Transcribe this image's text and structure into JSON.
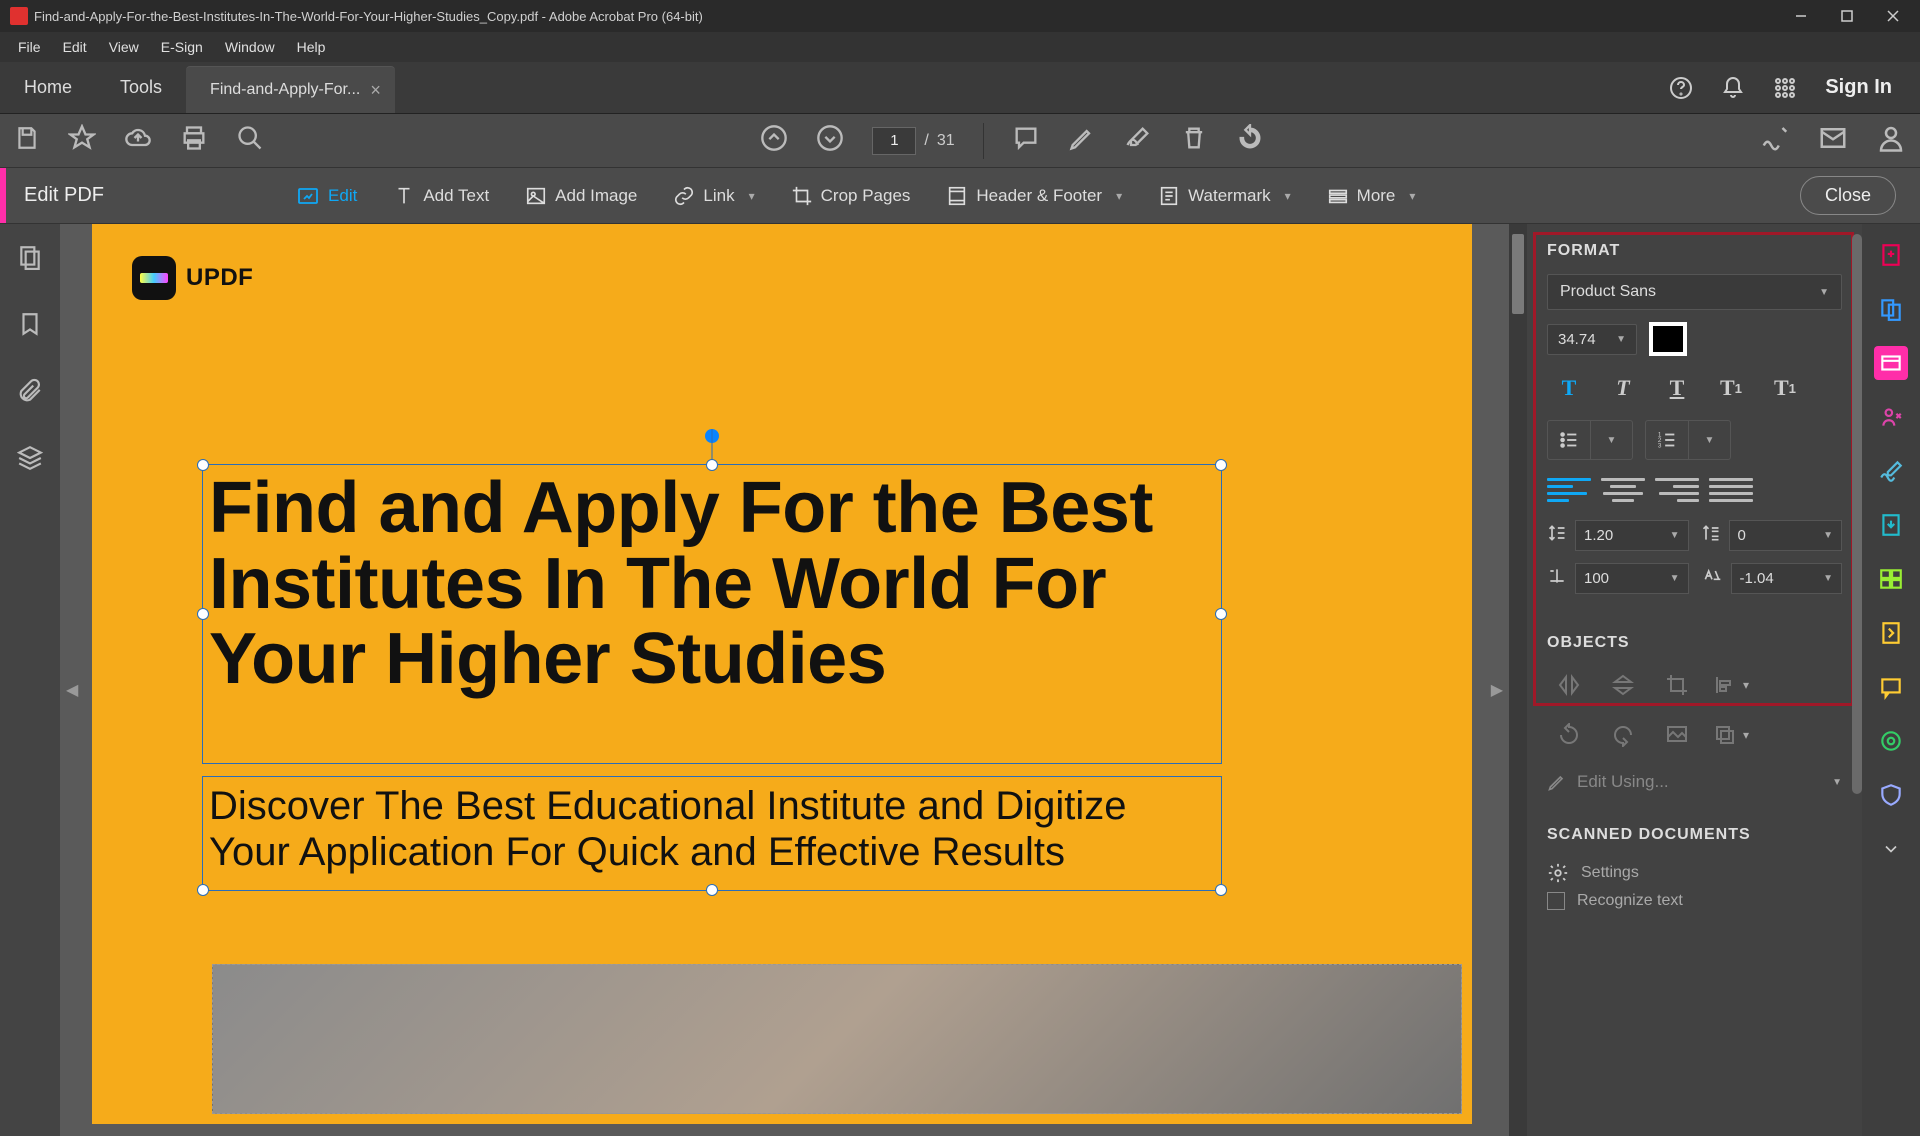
{
  "titlebar": {
    "title": "Find-and-Apply-For-the-Best-Institutes-In-The-World-For-Your-Higher-Studies_Copy.pdf - Adobe Acrobat Pro (64-bit)"
  },
  "menubar": {
    "items": [
      "File",
      "Edit",
      "View",
      "E-Sign",
      "Window",
      "Help"
    ]
  },
  "tabs": {
    "home": "Home",
    "tools": "Tools",
    "docname": "Find-and-Apply-For...",
    "signin": "Sign In"
  },
  "page": {
    "current": "1",
    "total": "31",
    "sep": "/"
  },
  "editpdf": {
    "label": "Edit PDF",
    "btns": {
      "edit": "Edit",
      "addtext": "Add Text",
      "addimage": "Add Image",
      "link": "Link",
      "crop": "Crop Pages",
      "header": "Header & Footer",
      "watermark": "Watermark",
      "more": "More"
    },
    "close": "Close"
  },
  "doc": {
    "logo_text": "UPDF",
    "h1": "Find and Apply For the Best Institutes In The World For Your Higher Studies",
    "h2": "Discover The Best Educational Institute and Digitize Your Application For Quick and Effective Results"
  },
  "format": {
    "head": "FORMAT",
    "font": "Product Sans",
    "size": "34.74",
    "line": "1.20",
    "paraspace": "0",
    "hscale": "100",
    "charspace": "-1.04"
  },
  "objects": {
    "head": "OBJECTS",
    "editusing": "Edit Using..."
  },
  "scanned": {
    "head": "SCANNED DOCUMENTS",
    "settings": "Settings",
    "recognize": "Recognize text"
  }
}
